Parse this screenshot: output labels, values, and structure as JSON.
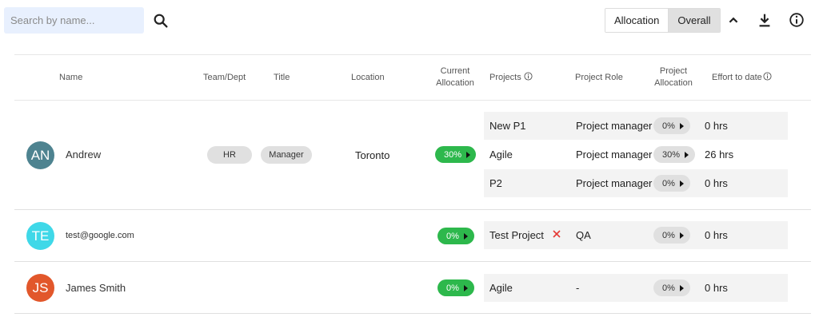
{
  "search": {
    "placeholder": "Search by name..."
  },
  "view_toggle": {
    "options": [
      "Allocation",
      "Overall"
    ],
    "selected": "Overall"
  },
  "columns": {
    "name": "Name",
    "team": "Team/Dept",
    "title": "Title",
    "location": "Location",
    "current_allocation": [
      "Current",
      "Allocation"
    ],
    "projects": "Projects",
    "project_role": "Project Role",
    "project_allocation": [
      "Project",
      "Allocation"
    ],
    "effort": "Effort to date"
  },
  "colors": {
    "allocation_green": "#2db84c",
    "remove_red": "#e53935"
  },
  "users": [
    {
      "initials": "AN",
      "name": "Andrew",
      "avatar_color": "#4e8390",
      "team": "HR",
      "title": "Manager",
      "location": "Toronto",
      "allocation": "30%",
      "projects": [
        {
          "name": "New P1",
          "role": "Project manager",
          "allocation": "0%",
          "effort": "0 hrs"
        },
        {
          "name": "Agile",
          "role": "Project manager",
          "allocation": "30%",
          "effort": "26 hrs"
        },
        {
          "name": "P2",
          "role": "Project manager",
          "allocation": "0%",
          "effort": "0 hrs"
        }
      ]
    },
    {
      "initials": "TE",
      "name": "test@google.com",
      "avatar_color": "#3fd8e8",
      "team": "",
      "title": "",
      "location": "",
      "allocation": "0%",
      "projects": [
        {
          "name": "Test Project",
          "role": "QA",
          "allocation": "0%",
          "effort": "0 hrs"
        }
      ]
    },
    {
      "initials": "JS",
      "name": "James Smith",
      "avatar_color": "#e2572b",
      "team": "",
      "title": "",
      "location": "",
      "allocation": "0%",
      "projects": [
        {
          "name": "Agile",
          "role": "-",
          "allocation": "0%",
          "effort": "0 hrs"
        }
      ]
    }
  ]
}
